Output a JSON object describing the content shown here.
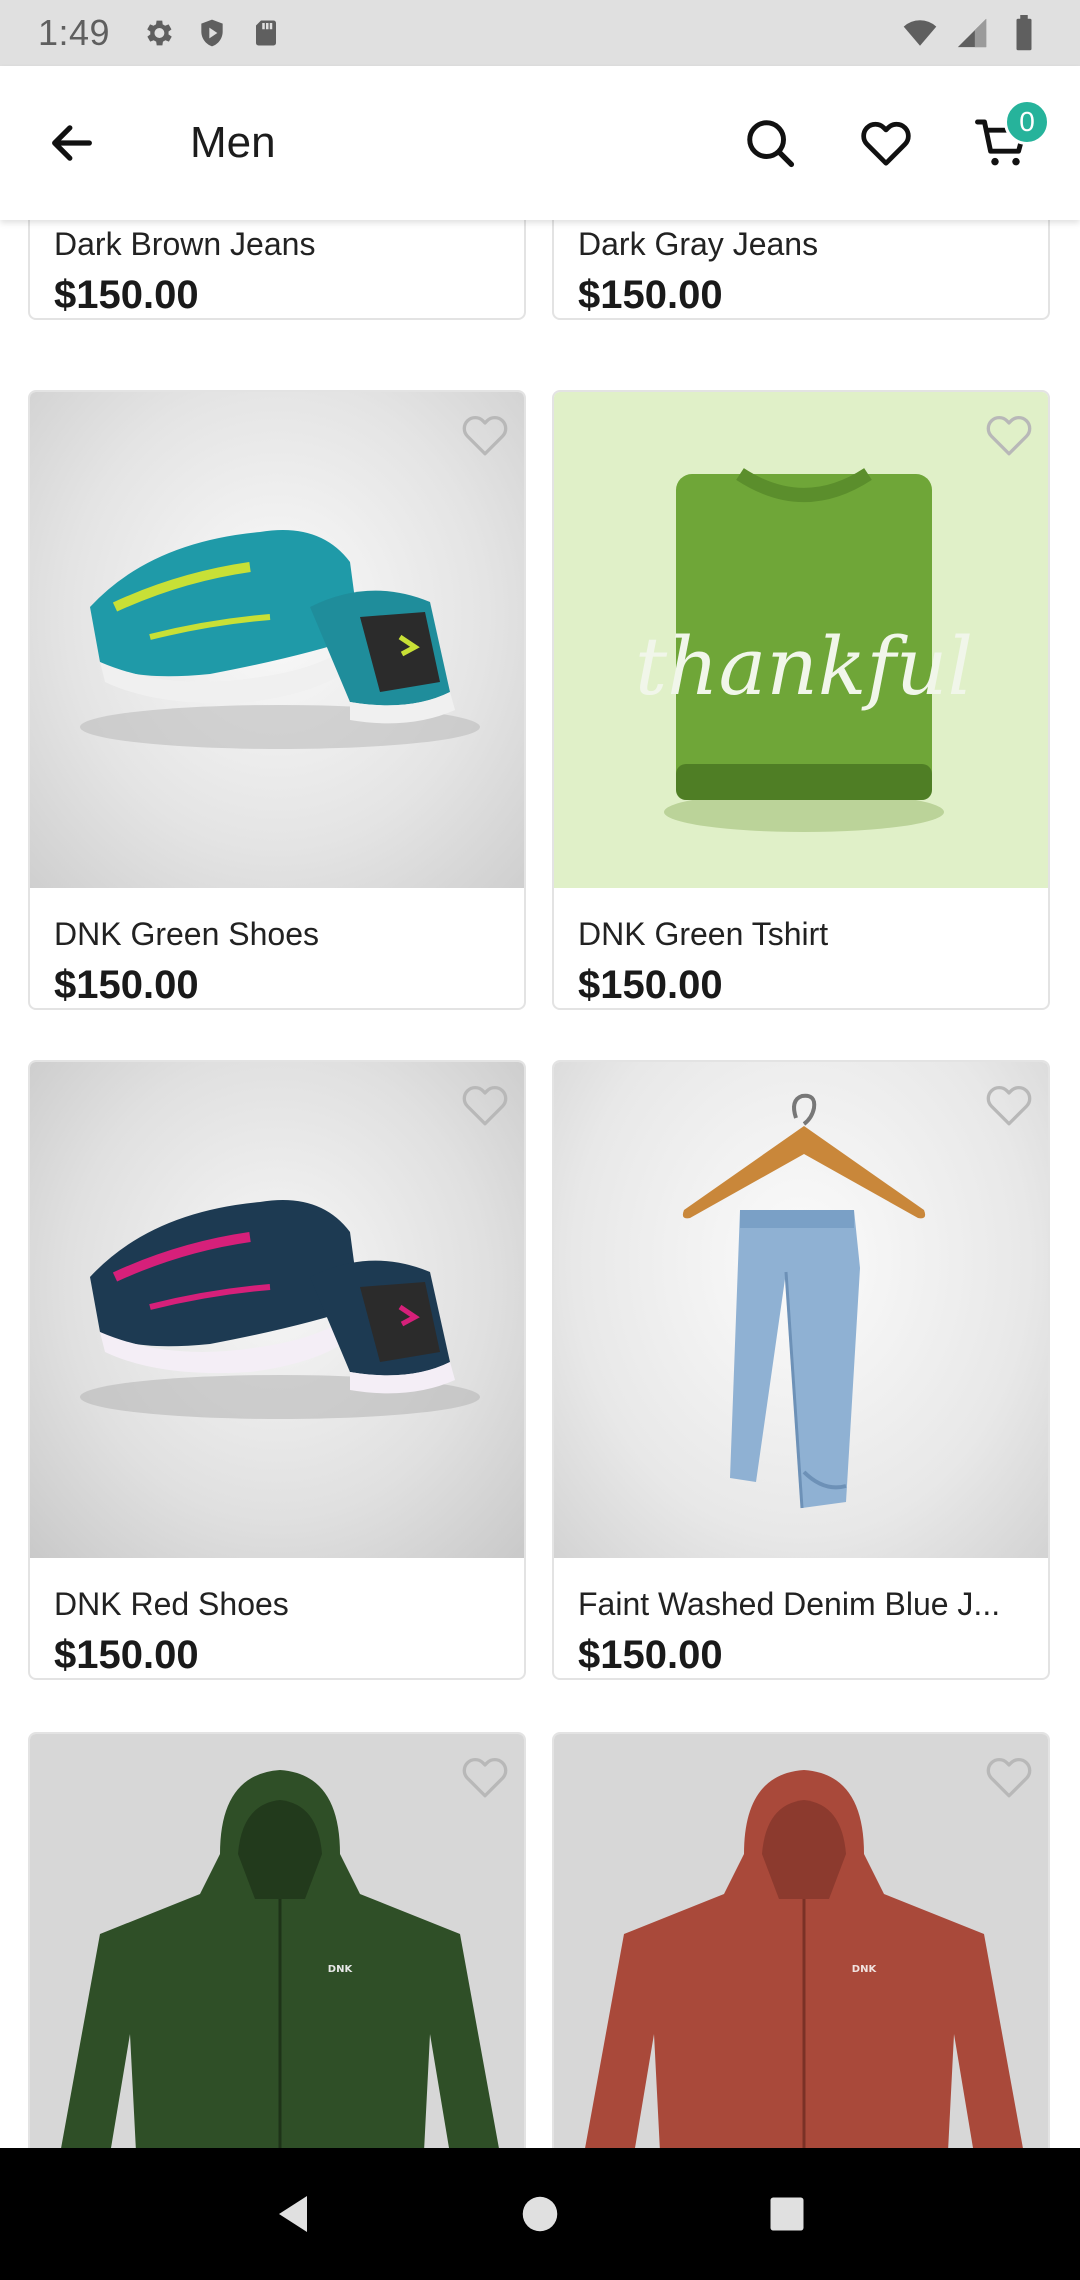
{
  "status_bar": {
    "time": "1:49",
    "icons_left": [
      "gear-icon",
      "shield-play-icon",
      "sd-card-icon"
    ],
    "icons_right": [
      "wifi-icon",
      "signal-icon",
      "battery-icon"
    ]
  },
  "app_bar": {
    "title": "Men",
    "cart_count": "0",
    "accent_color": "#26b39b"
  },
  "products": [
    {
      "name": "Dark Brown Jeans",
      "price": "$150.00",
      "image": "dark-brown-jeans-image"
    },
    {
      "name": "Dark Gray Jeans",
      "price": "$150.00",
      "image": "dark-gray-jeans-image"
    },
    {
      "name": "DNK Green Shoes",
      "price": "$150.00",
      "image": "green-shoes-image"
    },
    {
      "name": "DNK Green Tshirt",
      "price": "$150.00",
      "image": "green-tshirt-image",
      "image_text": "thankful"
    },
    {
      "name": "DNK Red Shoes",
      "price": "$150.00",
      "image": "red-shoes-image"
    },
    {
      "name": "Faint Washed Denim Blue J...",
      "price": "$150.00",
      "image": "denim-on-hanger-image"
    },
    {
      "name": "",
      "price": "",
      "image": "green-hoodie-image",
      "image_text": "DNK"
    },
    {
      "name": "",
      "price": "",
      "image": "red-hoodie-image",
      "image_text": "DNK"
    }
  ],
  "nav_bar": {
    "buttons": [
      "back-triangle-icon",
      "home-circle-icon",
      "recents-square-icon"
    ]
  }
}
